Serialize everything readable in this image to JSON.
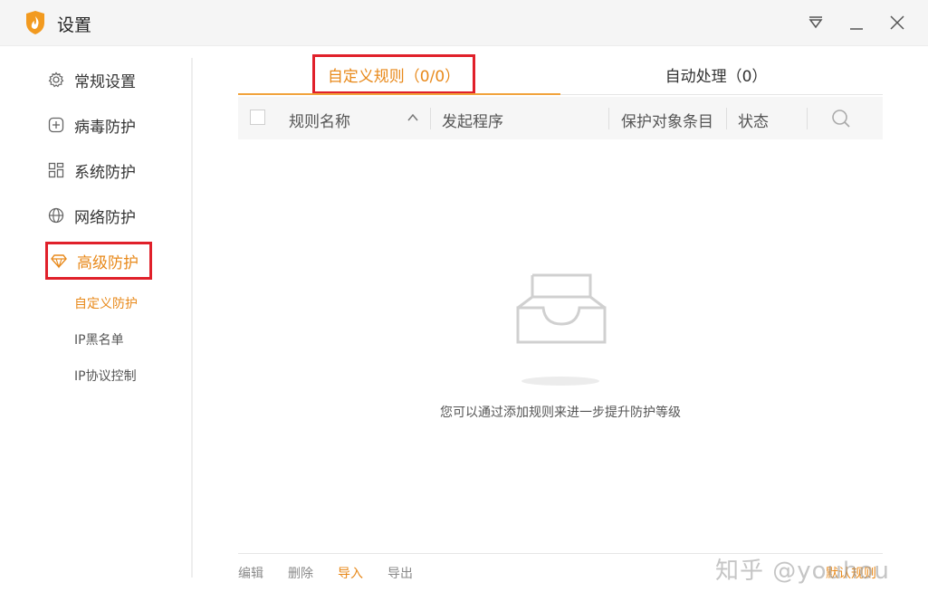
{
  "window": {
    "title": "设置"
  },
  "sidebar": {
    "items": [
      {
        "label": "常规设置"
      },
      {
        "label": "病毒防护"
      },
      {
        "label": "系统防护"
      },
      {
        "label": "网络防护"
      },
      {
        "label": "高级防护"
      }
    ],
    "sub_items": [
      {
        "label": "自定义防护"
      },
      {
        "label": "IP黑名单"
      },
      {
        "label": "IP协议控制"
      }
    ]
  },
  "tabs": [
    {
      "label": "自定义规则（0/0）"
    },
    {
      "label": "自动处理（0）"
    }
  ],
  "table": {
    "columns": [
      "规则名称",
      "发起程序",
      "保护对象条目",
      "状态"
    ]
  },
  "empty_state": {
    "message": "您可以通过添加规则来进一步提升防护等级"
  },
  "footer": {
    "actions": [
      "编辑",
      "删除",
      "导入",
      "导出"
    ],
    "right_link": "默认规则"
  },
  "watermark": "知乎 @youhou",
  "colors": {
    "accent": "#e8891a",
    "highlight_box": "#e0202a"
  }
}
